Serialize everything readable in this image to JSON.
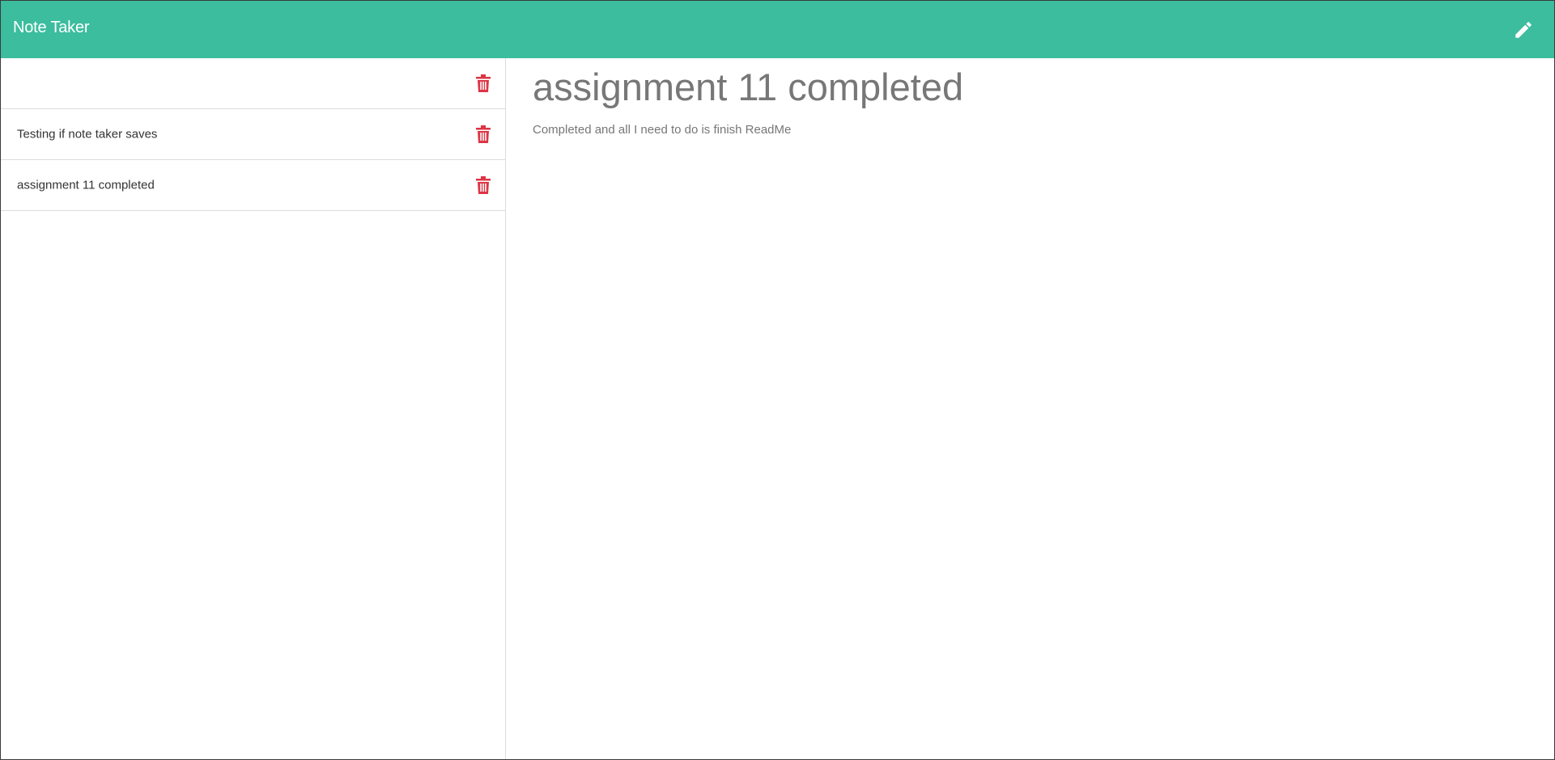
{
  "navbar": {
    "brand": "Note Taker",
    "new_note_icon": "pencil-icon",
    "background": "#3bbd9e"
  },
  "sidebar": {
    "notes": [
      {
        "title": "",
        "delete_icon": "trash-icon"
      },
      {
        "title": "Testing if note taker saves",
        "delete_icon": "trash-icon"
      },
      {
        "title": "assignment 11 completed",
        "delete_icon": "trash-icon"
      }
    ]
  },
  "editor": {
    "title": "assignment 11 completed",
    "text": "Completed and all I need to do is finish ReadMe"
  },
  "colors": {
    "accent": "#3bbd9e",
    "delete": "#dc3545",
    "muted_text": "#777777"
  }
}
